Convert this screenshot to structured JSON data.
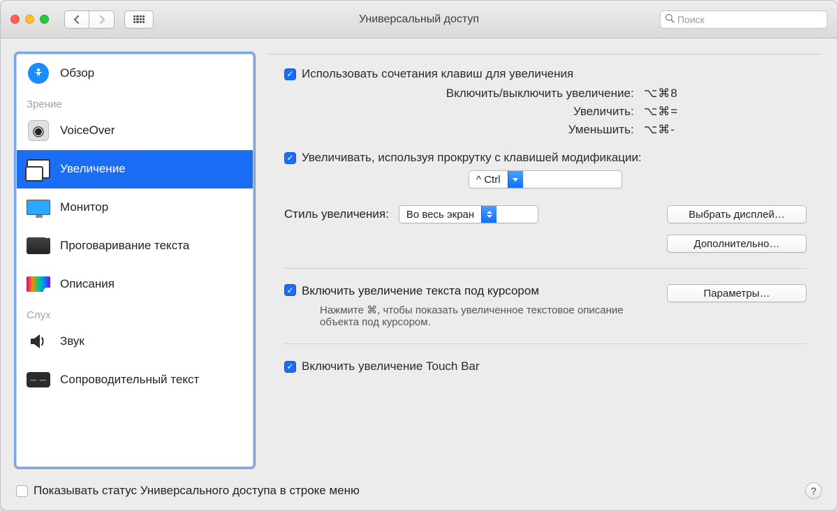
{
  "window_title": "Универсальный доступ",
  "search_placeholder": "Поиск",
  "sidebar": {
    "overview": "Обзор",
    "section_vision": "Зрение",
    "voiceover": "VoiceOver",
    "zoom": "Увеличение",
    "display": "Монитор",
    "speech": "Проговаривание текста",
    "descriptions": "Описания",
    "section_hearing": "Слух",
    "audio": "Звук",
    "captions": "Сопроводительный текст"
  },
  "zoom": {
    "use_shortcuts": "Использовать сочетания клавиш для увеличения",
    "toggle_label": "Включить/выключить увеличение:",
    "toggle_keys": "⌥⌘8",
    "zoom_in_label": "Увеличить:",
    "zoom_in_keys": "⌥⌘=",
    "zoom_out_label": "Уменьшить:",
    "zoom_out_keys": "⌥⌘-",
    "scroll_modifier": "Увеличивать, используя прокрутку с клавишей модификации:",
    "scroll_modifier_value": "^ Ctrl",
    "style_label": "Стиль увеличения:",
    "style_value": "Во весь экран",
    "choose_display_btn": "Выбрать дисплей…",
    "advanced_btn": "Дополнительно…",
    "hover_text": "Включить увеличение текста под курсором",
    "hover_desc": "Нажмите ⌘, чтобы показать увеличенное текстовое описание объекта под курсором.",
    "hover_options_btn": "Параметры…",
    "touchbar": "Включить увеличение Touch Bar"
  },
  "footer": {
    "menubar_status": "Показывать статус Универсального доступа в строке меню"
  }
}
